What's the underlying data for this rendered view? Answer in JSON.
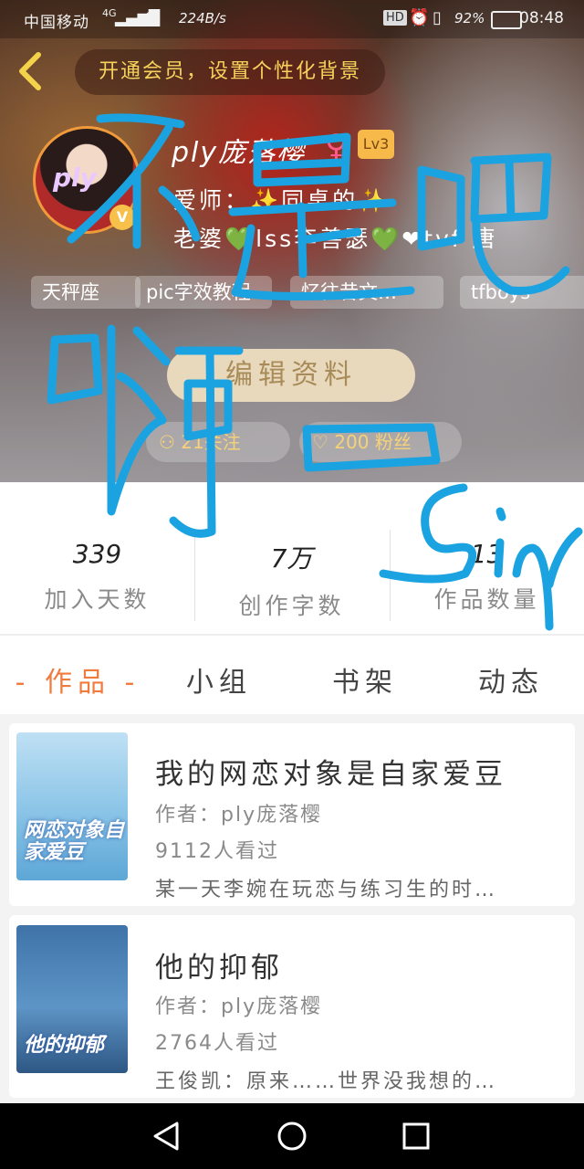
{
  "status_bar": {
    "carrier": "中国移动",
    "network": "4G",
    "speed": "224B/s",
    "hd": "HD",
    "battery": "92%",
    "time": "08:48"
  },
  "header": {
    "vip_banner": "开通会员，设置个性化背景"
  },
  "profile": {
    "avatar_text": "ply",
    "avatar_badge": "V",
    "name": "ply庞落樱",
    "level": "Lv3",
    "bio_line1": "爱师：✨同桌的✨",
    "bio_line2": "老婆💚lss李善瑟💚❤tvf 唐",
    "tags": [
      "天秤座",
      "pic字效教程",
      "忆往昔文…",
      "tfboys"
    ],
    "edit_button": "编辑资料",
    "following": "21关注",
    "fans": "200 粉丝"
  },
  "stats": [
    {
      "value": "339",
      "label": "加入天数"
    },
    {
      "value": "7万",
      "label": "创作字数"
    },
    {
      "value": "13",
      "label": "作品数量"
    }
  ],
  "tabs": [
    {
      "label": "作品",
      "active": true
    },
    {
      "label": "小组",
      "active": false
    },
    {
      "label": "书架",
      "active": false
    },
    {
      "label": "动态",
      "active": false
    }
  ],
  "works": [
    {
      "title": "我的网恋对象是自家爱豆",
      "author": "作者：ply庞落樱",
      "views": "9112人看过",
      "desc": "某一天李婉在玩恋与练习生的时…",
      "cover_text": "网恋对象自家爱豆"
    },
    {
      "title": "他的抑郁",
      "author": "作者：ply庞落樱",
      "views": "2764人看过",
      "desc": "王俊凯：原来……世界没我想的…",
      "cover_text": "他的抑郁"
    }
  ],
  "overlay": {
    "scribble_text": "不是吧 啊 Sin"
  },
  "colors": {
    "accent": "#f07b3f",
    "vip": "#f6d25c",
    "scribble": "#1aa3e0"
  }
}
